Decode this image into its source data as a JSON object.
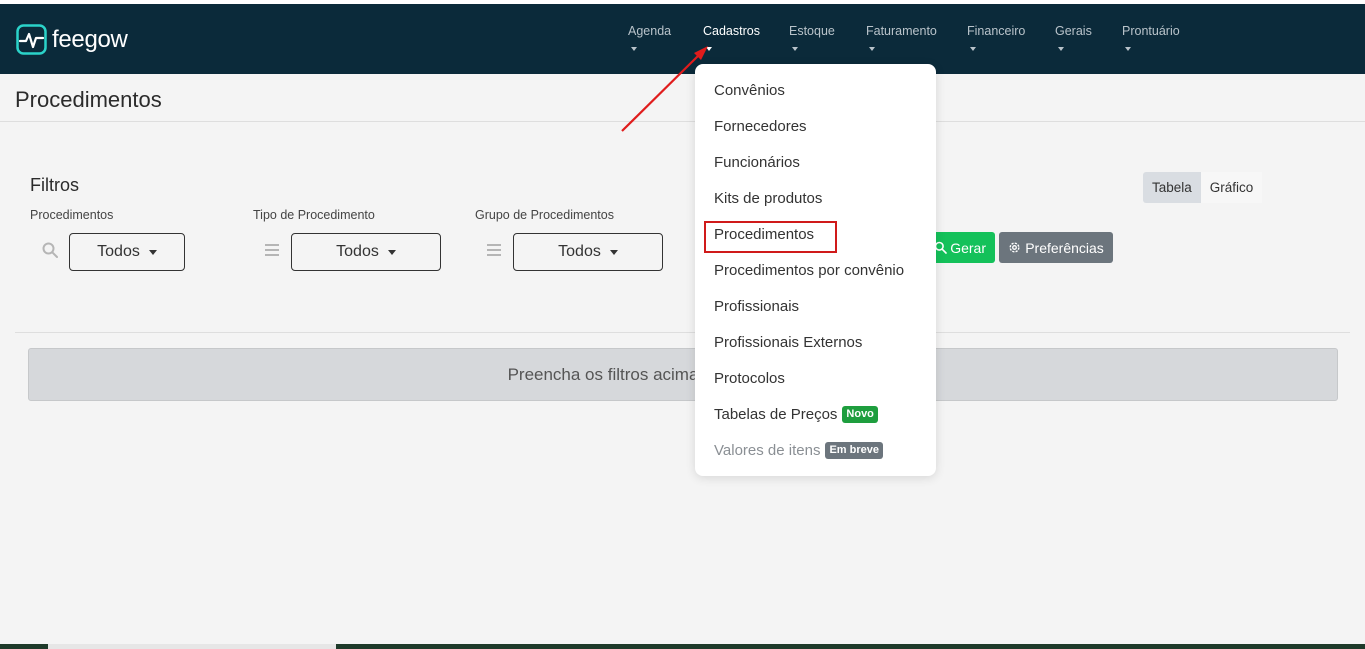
{
  "app": {
    "logo_text": "feegow",
    "brand_color": "#0b2a3a",
    "accent_color": "#14c15a"
  },
  "nav": {
    "items": [
      {
        "label": "Agenda"
      },
      {
        "label": "Cadastros"
      },
      {
        "label": "Estoque"
      },
      {
        "label": "Faturamento"
      },
      {
        "label": "Financeiro"
      },
      {
        "label": "Gerais"
      },
      {
        "label": "Prontuário"
      }
    ],
    "active": "Cadastros"
  },
  "page": {
    "title": "Procedimentos"
  },
  "filters": {
    "title": "Filtros",
    "fields": [
      {
        "label": "Procedimentos",
        "icon": "search-icon",
        "value": "Todos"
      },
      {
        "label": "Tipo de Procedimento",
        "icon": "list-icon",
        "value": "Todos"
      },
      {
        "label": "Grupo de Procedimentos",
        "icon": "list-icon",
        "value": "Todos"
      }
    ]
  },
  "view_toggle": {
    "options": [
      "Tabela",
      "Gráfico"
    ],
    "selected": "Tabela"
  },
  "actions": {
    "generate_label": "Gerar",
    "preferences_label": "Preferências"
  },
  "message": {
    "text": "Preencha os filtros acima"
  },
  "dropdown": {
    "items": [
      {
        "label": "Convênios"
      },
      {
        "label": "Fornecedores"
      },
      {
        "label": "Funcionários"
      },
      {
        "label": "Kits de produtos"
      },
      {
        "label": "Procedimentos",
        "highlighted": true
      },
      {
        "label": "Procedimentos por convênio"
      },
      {
        "label": "Profissionais"
      },
      {
        "label": "Profissionais Externos"
      },
      {
        "label": "Protocolos"
      },
      {
        "label": "Tabelas de Preços",
        "badge": "Novo"
      },
      {
        "label": "Valores de itens",
        "badge": "Em breve",
        "disabled": true
      }
    ]
  }
}
